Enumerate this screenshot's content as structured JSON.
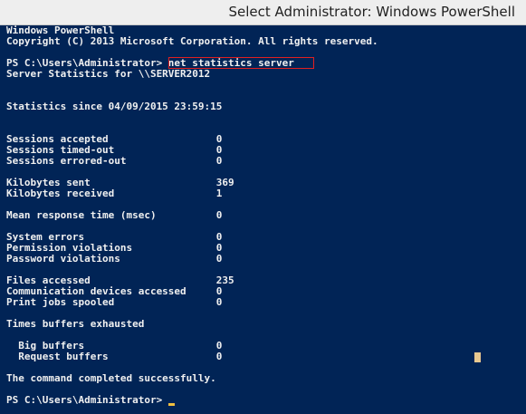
{
  "window": {
    "title": "Select Administrator: Windows PowerShell"
  },
  "console": {
    "lines": [
      "Windows PowerShell",
      "Copyright (C) 2013 Microsoft Corporation. All rights reserved.",
      "",
      "PS C:\\Users\\Administrator> net statistics server",
      "Server Statistics for \\\\SERVER2012",
      "",
      "",
      "Statistics since 04/09/2015 23:59:15",
      "",
      "",
      "Sessions accepted                  0",
      "Sessions timed-out                 0",
      "Sessions errored-out               0",
      "",
      "Kilobytes sent                     369",
      "Kilobytes received                 1",
      "",
      "Mean response time (msec)          0",
      "",
      "System errors                      0",
      "Permission violations              0",
      "Password violations                0",
      "",
      "Files accessed                     235",
      "Communication devices accessed     0",
      "Print jobs spooled                 0",
      "",
      "Times buffers exhausted",
      "",
      "  Big buffers                      0",
      "  Request buffers                  0",
      "",
      "The command completed successfully.",
      "",
      "PS C:\\Users\\Administrator> "
    ]
  },
  "colors": {
    "console_background": "#012456",
    "console_text": "#f0f0f0",
    "highlight_border": "#e02020",
    "cursor": "#f0c040"
  }
}
